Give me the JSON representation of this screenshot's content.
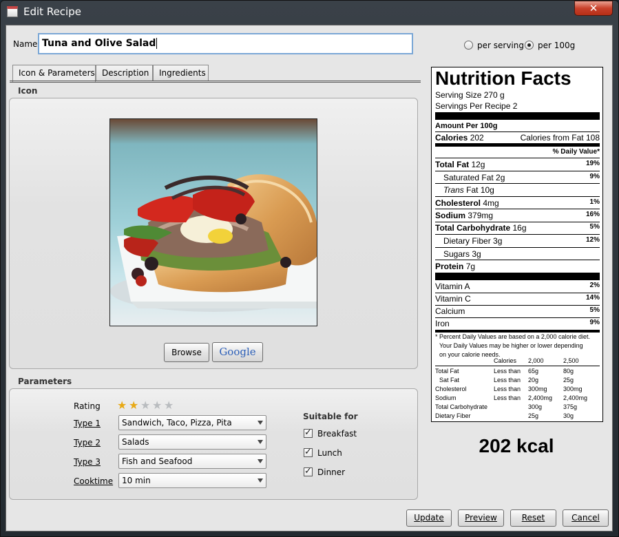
{
  "window": {
    "title": "Edit Recipe",
    "close_glyph": "✕"
  },
  "name": {
    "label": "Name",
    "value": "Tuna and Olive Salad"
  },
  "unit_options": [
    {
      "label": "per serving",
      "selected": false
    },
    {
      "label": "per 100g",
      "selected": true
    }
  ],
  "tabs": [
    "Icon & Parameters",
    "Description",
    "Ingredients"
  ],
  "icon_section": {
    "title": "Icon",
    "browse_label": "Browse",
    "google_label": "Google"
  },
  "parameters": {
    "title": "Parameters",
    "rating_label": "Rating",
    "rating": 2,
    "rating_max": 5,
    "type1_label": "Type 1",
    "type1_value": "Sandwich, Taco, Pizza, Pita",
    "type2_label": "Type 2",
    "type2_value": "Salads",
    "type3_label": "Type 3",
    "type3_value": "Fish and Seafood",
    "cooktime_label": "Cooktime",
    "cooktime_value": "10 min",
    "suitable_title": "Suitable for",
    "suitable": [
      {
        "label": "Breakfast",
        "checked": true
      },
      {
        "label": "Lunch",
        "checked": true
      },
      {
        "label": "Dinner",
        "checked": true
      }
    ]
  },
  "nutrition": {
    "title": "Nutrition Facts",
    "serving_size": "Serving Size 270 g",
    "servings": "Servings Per Recipe 2",
    "amount_per": "Amount Per 100g",
    "calories_label": "Calories",
    "calories_value": "202",
    "calories_fat": "Calories from Fat 108",
    "dv_header": "% Daily Value*",
    "total_fat_label": "Total Fat",
    "total_fat_value": "12g",
    "total_fat_dv": "19%",
    "sat_fat_label": "Saturated Fat 2g",
    "sat_fat_dv": "9%",
    "trans_label": "Trans",
    "trans_rest": "Fat 10g",
    "chol_label": "Cholesterol",
    "chol_value": "4mg",
    "chol_dv": "1%",
    "sodium_label": "Sodium",
    "sodium_value": "379mg",
    "sodium_dv": "16%",
    "carb_label": "Total Carbohydrate",
    "carb_value": "16g",
    "carb_dv": "5%",
    "fiber_label": "Dietary Fiber 3g",
    "fiber_dv": "12%",
    "sugars_label": "Sugars 3g",
    "protein_label": "Protein",
    "protein_value": "7g",
    "vita_label": "Vitamin A",
    "vita_dv": "2%",
    "vitc_label": "Vitamin C",
    "vitc_dv": "14%",
    "calcium_label": "Calcium",
    "calcium_dv": "5%",
    "iron_label": "Iron",
    "iron_dv": "9%",
    "footnote_1": "* Percent Daily Values are based on a 2,000 calorie diet.",
    "footnote_2": "Your Daily Values may be higher or lower depending",
    "footnote_3": "on your calorie needs.",
    "table_header": [
      "Calories",
      "2,000",
      "2,500"
    ],
    "table_rows": [
      [
        "Total Fat",
        "Less than",
        "65g",
        "80g"
      ],
      [
        "Sat Fat",
        "Less than",
        "20g",
        "25g"
      ],
      [
        "Cholesterol",
        "Less than",
        "300mg",
        "300mg"
      ],
      [
        "Sodium",
        "Less than",
        "2,400mg",
        "2,400mg"
      ],
      [
        "Total Carbohydrate",
        "",
        "300g",
        "375g"
      ],
      [
        "Dietary Fiber",
        "",
        "25g",
        "30g"
      ]
    ]
  },
  "kcal": "202 kcal",
  "buttons": {
    "update": "Update",
    "preview": "Preview",
    "reset": "Reset",
    "cancel": "Cancel"
  }
}
